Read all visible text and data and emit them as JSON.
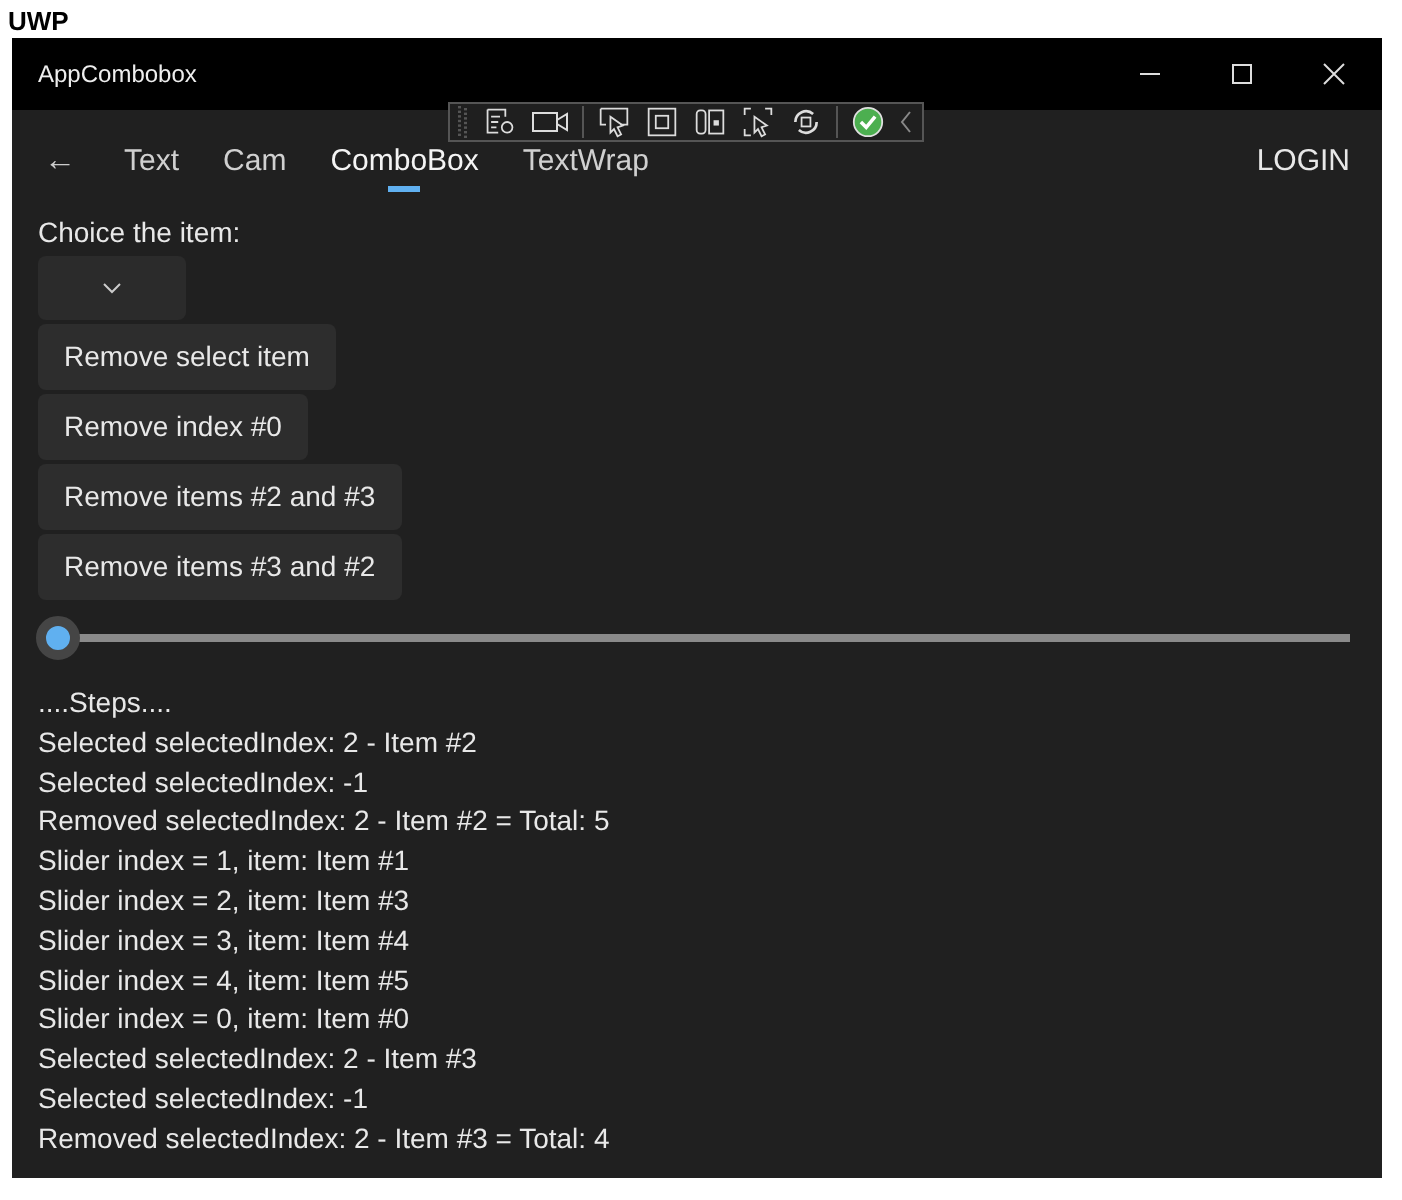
{
  "caption": "UWP",
  "window": {
    "title": "AppCombobox"
  },
  "nav": {
    "back": "←",
    "tabs": [
      {
        "label": "Text",
        "selected": false
      },
      {
        "label": "Cam",
        "selected": false
      },
      {
        "label": "ComboBox",
        "selected": true
      },
      {
        "label": "TextWrap",
        "selected": false
      }
    ],
    "login": "LOGIN"
  },
  "label": "Choice the item:",
  "buttons": [
    "Remove select item",
    "Remove index #0",
    "Remove items #2 and #3",
    "Remove items #3 and #2"
  ],
  "slider": {
    "level": 0
  },
  "log": [
    "....Steps....",
    "Selected selectedIndex: 2 - Item #2",
    "Selected selectedIndex: -1",
    "Removed selectedIndex: 2 - Item #2 = Total: 5",
    "Slider index = 1, item: Item #1",
    "Slider index = 2, item: Item #3",
    "Slider index = 3, item: Item #4",
    "Slider index = 4, item: Item #5",
    "Slider index = 0, item: Item #0",
    "Selected selectedIndex: 2 - Item #3",
    "Selected selectedIndex: -1",
    "Removed selectedIndex: 2 - Item #3 = Total: 4"
  ]
}
